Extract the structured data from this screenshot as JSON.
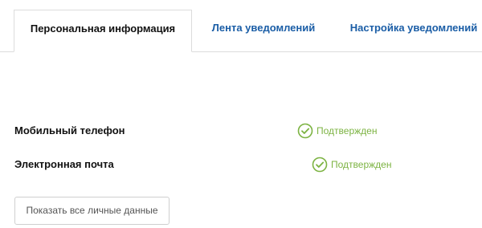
{
  "tabs": [
    {
      "label": "Персональная информация",
      "active": true
    },
    {
      "label": "Лента уведомлений",
      "active": false
    },
    {
      "label": "Настройка уведомлений",
      "active": false
    }
  ],
  "rows": [
    {
      "label": "Мобильный телефон",
      "status": "Подтвержден",
      "status_icon": "check-circle-icon"
    },
    {
      "label": "Электронная почта",
      "status": "Подтвержден",
      "status_icon": "check-circle-icon"
    }
  ],
  "show_all_button": "Показать все личные данные",
  "colors": {
    "link": "#1a5da6",
    "confirmed": "#7cb342",
    "border": "#dcdcdc"
  }
}
